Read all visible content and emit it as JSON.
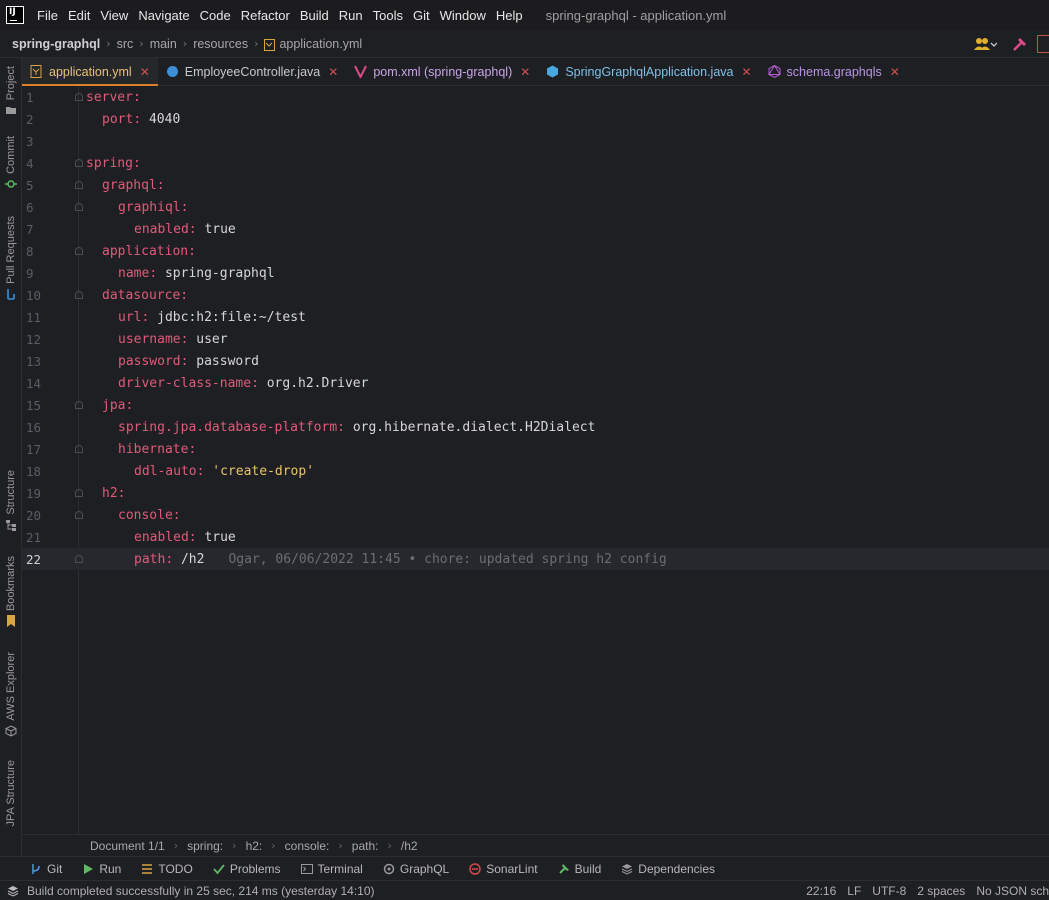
{
  "menubar": {
    "items": [
      "File",
      "Edit",
      "View",
      "Navigate",
      "Code",
      "Refactor",
      "Build",
      "Run",
      "Tools",
      "Git",
      "Window",
      "Help"
    ],
    "window_title": "spring-graphql - application.yml"
  },
  "navbar": {
    "crumbs": [
      "spring-graphql",
      "src",
      "main",
      "resources",
      "application.yml"
    ]
  },
  "left_strip": {
    "items": [
      "Project",
      "Commit",
      "Pull Requests",
      "Structure",
      "Bookmarks",
      "AWS Explorer",
      "JPA Structure"
    ]
  },
  "tabs": [
    {
      "label": "application.yml",
      "icon": "yaml-icon",
      "active": true
    },
    {
      "label": "EmployeeController.java",
      "icon": "java-class-icon",
      "active": false
    },
    {
      "label": "pom.xml (spring-graphql)",
      "icon": "maven-icon",
      "active": false
    },
    {
      "label": "SpringGraphqlApplication.java",
      "icon": "spring-class-icon",
      "active": false
    },
    {
      "label": "schema.graphqls",
      "icon": "graphql-icon",
      "active": false
    }
  ],
  "editor": {
    "current_line": 22,
    "lines": [
      {
        "n": "1",
        "key": "server",
        "value": ""
      },
      {
        "n": "2",
        "key": "port",
        "value": "4040"
      },
      {
        "n": "3",
        "key": "",
        "value": ""
      },
      {
        "n": "4",
        "key": "spring",
        "value": ""
      },
      {
        "n": "5",
        "key": "graphql",
        "value": ""
      },
      {
        "n": "6",
        "key": "graphiql",
        "value": ""
      },
      {
        "n": "7",
        "key": "enabled",
        "value": "true"
      },
      {
        "n": "8",
        "key": "application",
        "value": ""
      },
      {
        "n": "9",
        "key": "name",
        "value": "spring-graphql"
      },
      {
        "n": "10",
        "key": "datasource",
        "value": ""
      },
      {
        "n": "11",
        "key": "url",
        "value": "jdbc:h2:file:~/test"
      },
      {
        "n": "12",
        "key": "username",
        "value": "user"
      },
      {
        "n": "13",
        "key": "password",
        "value": "password"
      },
      {
        "n": "14",
        "key": "driver-class-name",
        "value": "org.h2.Driver"
      },
      {
        "n": "15",
        "key": "jpa",
        "value": ""
      },
      {
        "n": "16",
        "key": "spring.jpa.database-platform",
        "value": "org.hibernate.dialect.H2Dialect"
      },
      {
        "n": "17",
        "key": "hibernate",
        "value": ""
      },
      {
        "n": "18",
        "key": "ddl-auto",
        "value": "'create-drop'"
      },
      {
        "n": "19",
        "key": "h2",
        "value": ""
      },
      {
        "n": "20",
        "key": "console",
        "value": ""
      },
      {
        "n": "21",
        "key": "enabled",
        "value": "true"
      },
      {
        "n": "22",
        "key": "path",
        "value": "/h2"
      }
    ],
    "blame": "Ogar, 06/06/2022 11:45 • chore: updated spring h2 config"
  },
  "bottom_crumbs": [
    "Document 1/1",
    "spring:",
    "h2:",
    "console:",
    "path:",
    "/h2"
  ],
  "tool_windows": [
    "Git",
    "Run",
    "TODO",
    "Problems",
    "Terminal",
    "GraphQL",
    "SonarLint",
    "Build",
    "Dependencies"
  ],
  "status": {
    "message": "Build completed successfully in 25 sec, 214 ms (yesterday 14:10)",
    "position": "22:16",
    "line_sep": "LF",
    "encoding": "UTF-8",
    "indent": "2 spaces",
    "schema": "No JSON sch"
  },
  "colors": {
    "key": "#e05a7a",
    "string": "#e8c46a",
    "active_tab": "#e8c07a",
    "tab_close": "#d05050"
  }
}
